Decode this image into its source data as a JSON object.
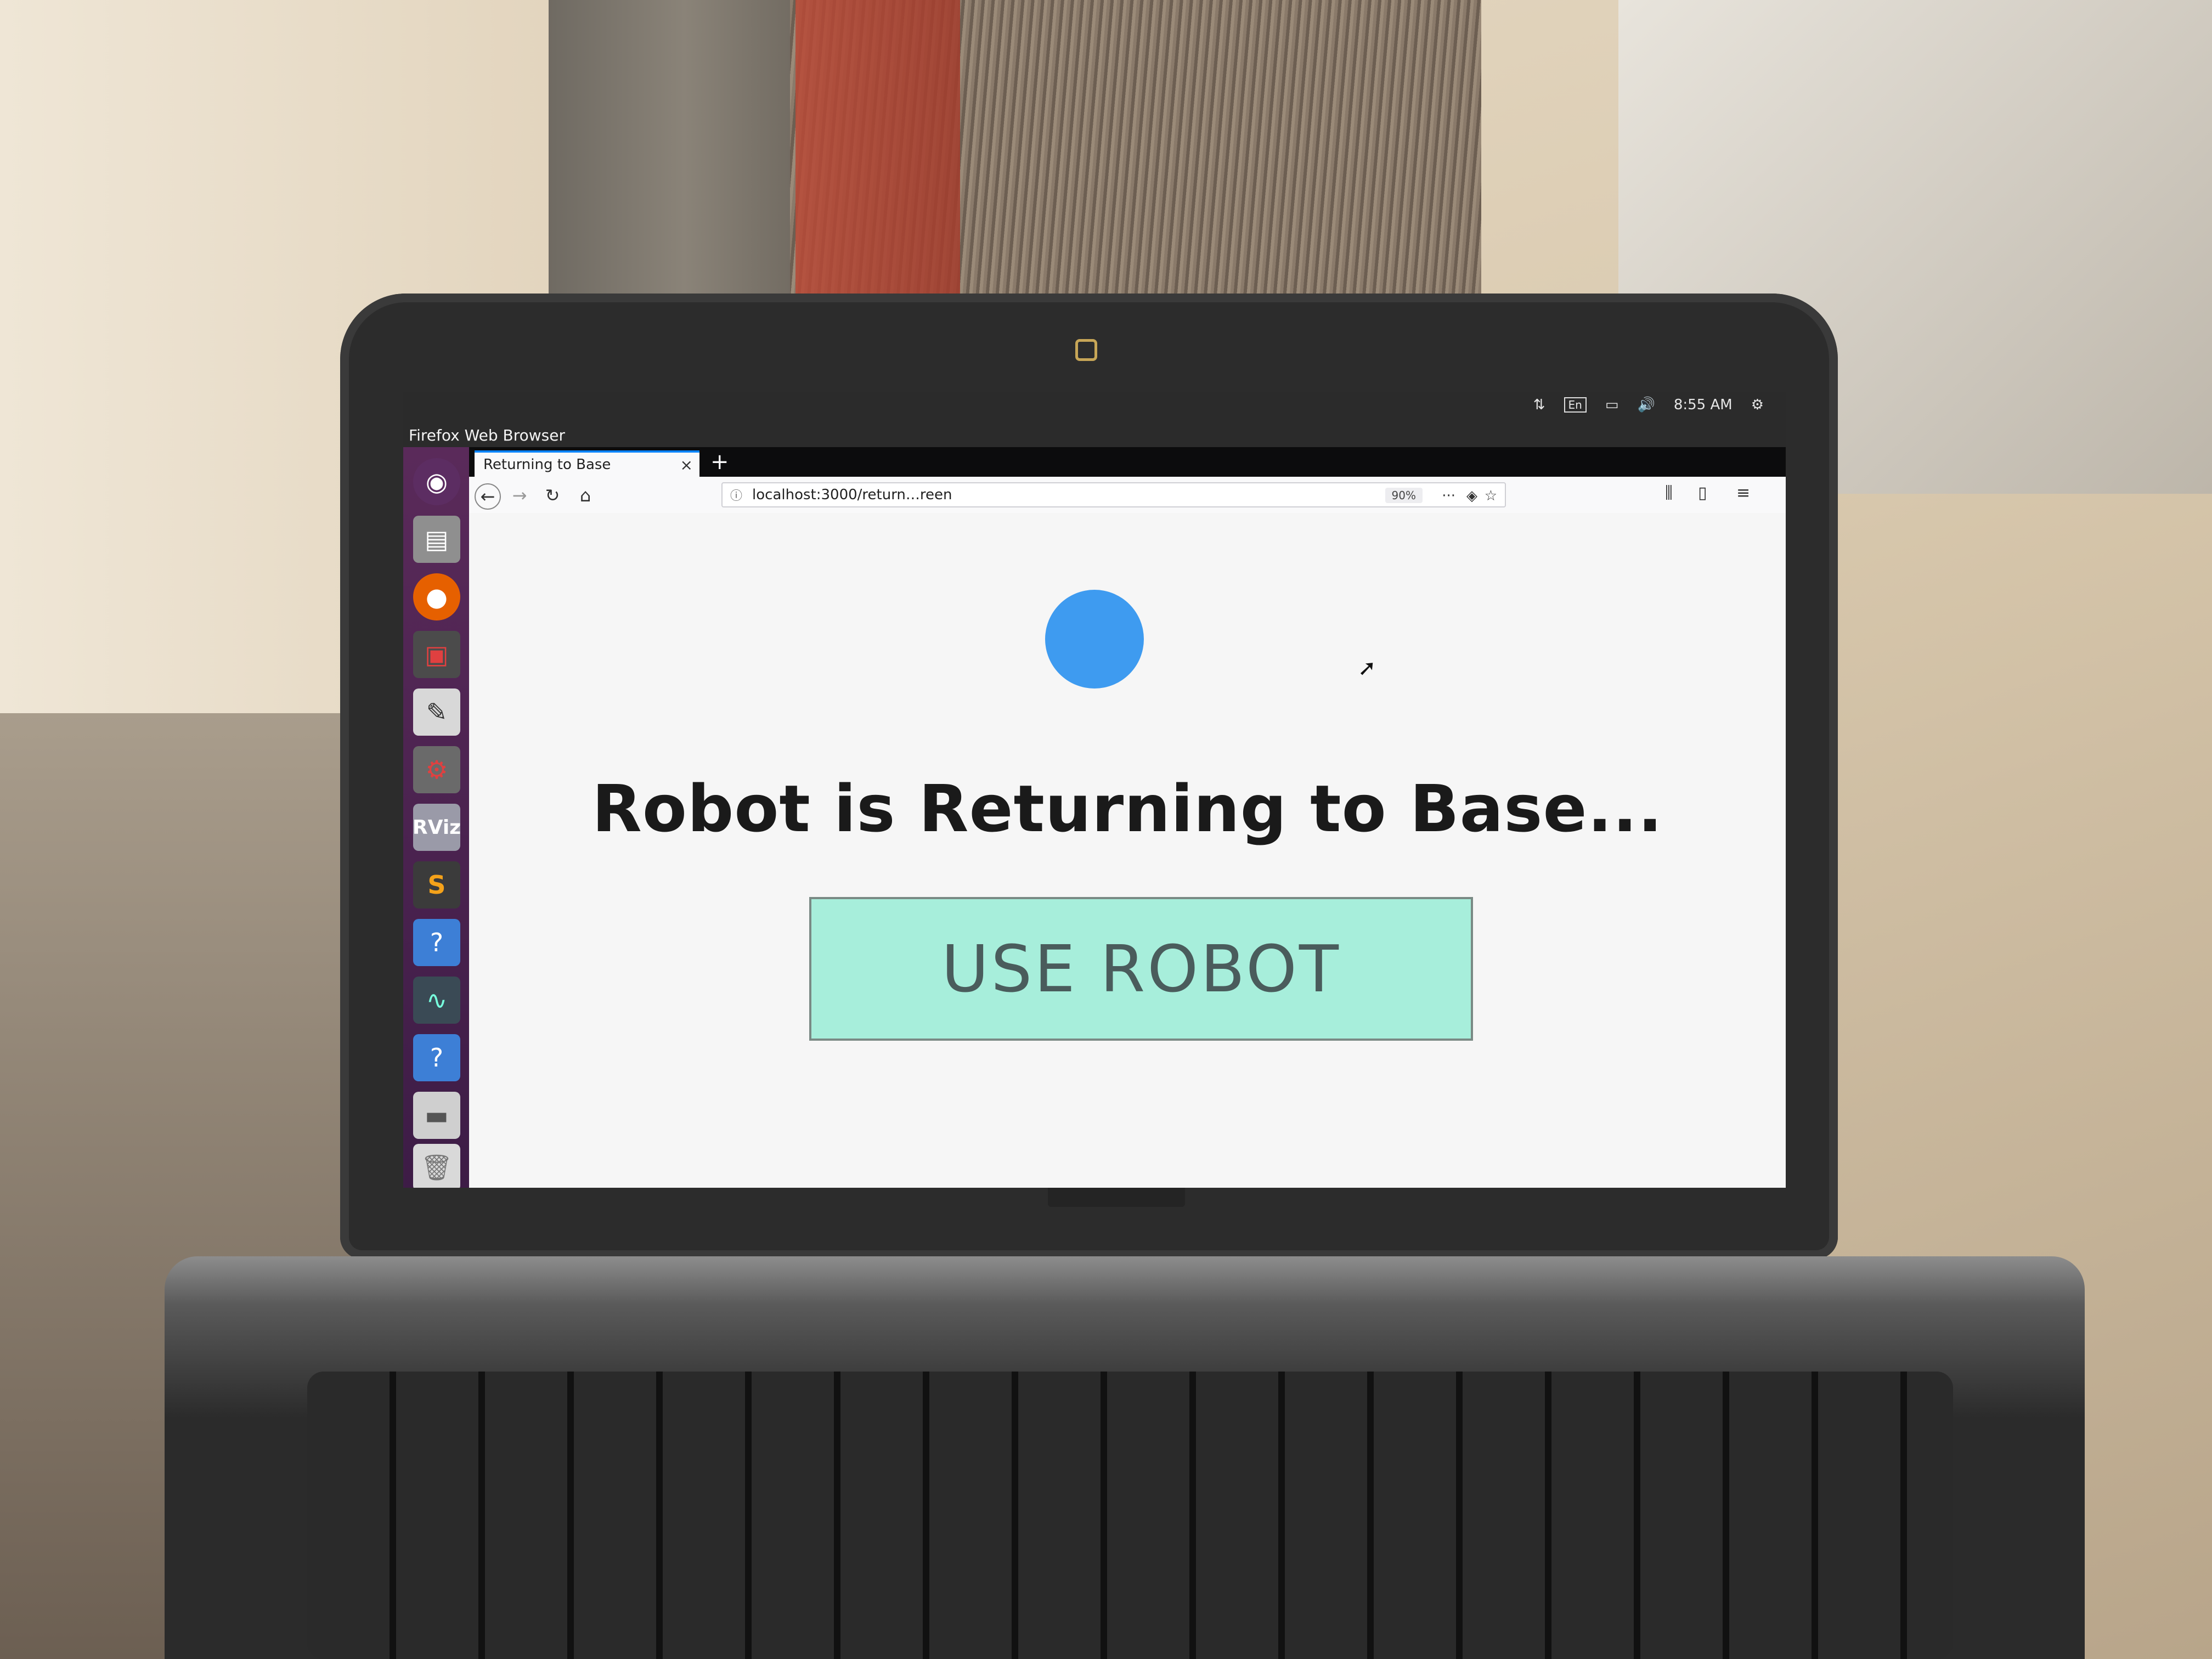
{
  "desktop": {
    "top_panel": {
      "app_title": "Firefox Web Browser",
      "keyboard_layout": "En",
      "clock": "8:55 AM"
    },
    "launcher": {
      "items": [
        {
          "icon": "ubuntu-dash-icon"
        },
        {
          "icon": "files-icon"
        },
        {
          "icon": "firefox-icon"
        },
        {
          "icon": "terminal-icon"
        },
        {
          "icon": "text-editor-icon"
        },
        {
          "icon": "settings-icon"
        },
        {
          "icon": "rviz-icon",
          "label": "RViz"
        },
        {
          "icon": "sublime-text-icon",
          "label": "S"
        },
        {
          "icon": "help-icon",
          "label": "?"
        },
        {
          "icon": "system-monitor-icon"
        },
        {
          "icon": "help-icon",
          "label": "?"
        },
        {
          "icon": "drive-icon"
        },
        {
          "icon": "trash-icon"
        }
      ]
    }
  },
  "browser": {
    "tab": {
      "title": "Returning to Base",
      "close": "×"
    },
    "new_tab": "+",
    "url": "localhost:3000/return…reen",
    "zoom": "90%",
    "page_actions_label": "···",
    "menu_label": "≡"
  },
  "page": {
    "status_title": "Robot is Returning to Base...",
    "use_robot_label": "USE ROBOT",
    "spinner_color": "#3e9bf0",
    "button_color": "#a7eedb"
  }
}
